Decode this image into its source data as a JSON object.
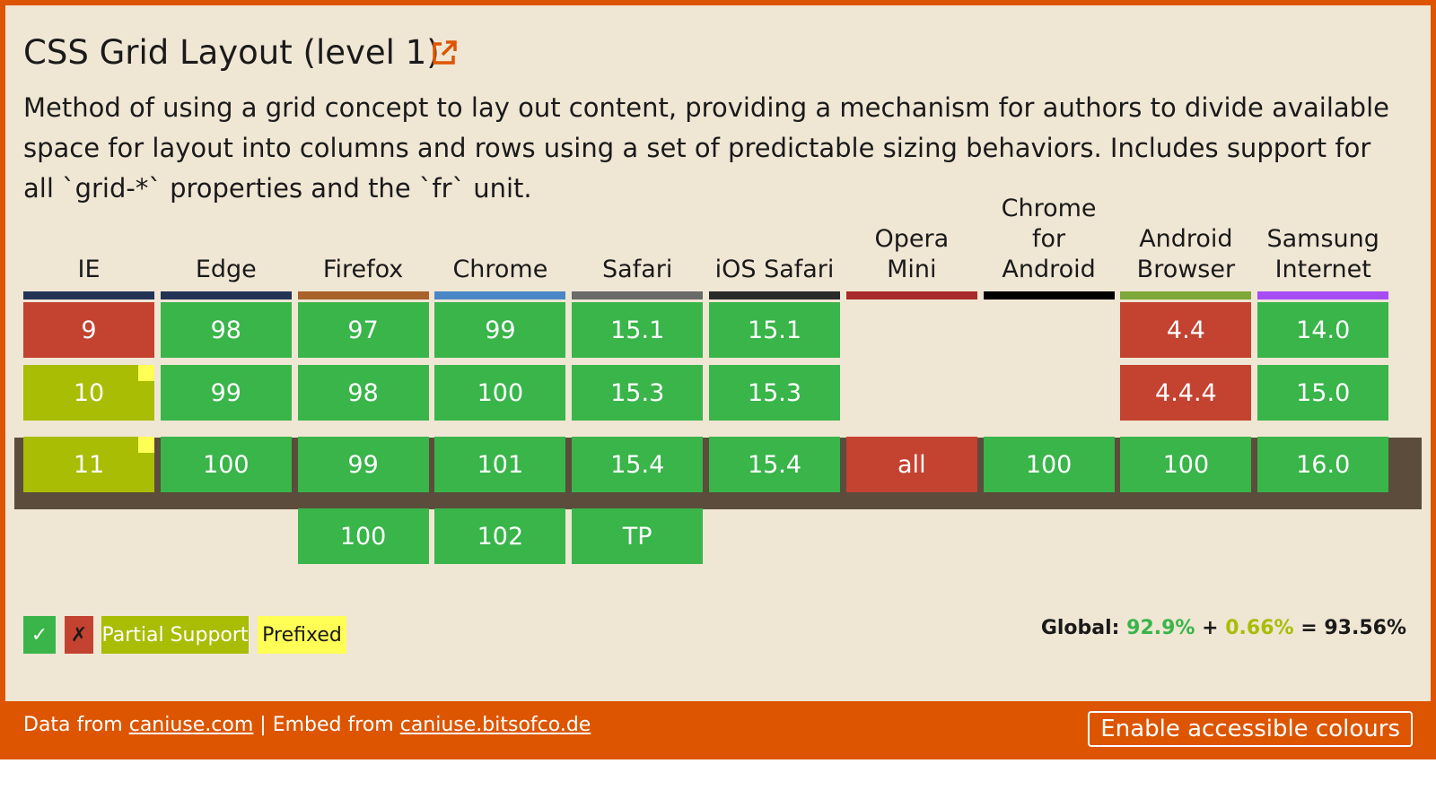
{
  "title": "CSS Grid Layout (level 1)",
  "description": "Method of using a grid concept to lay out content, providing a mechanism for authors to divide available space for layout into columns and rows using a set of predictable sizing behaviors. Includes support for all `grid-*` properties and the `fr` unit.",
  "icons": {
    "external_link": "external-link-icon"
  },
  "colors": {
    "supported": "#39b54a",
    "unsupported": "#c44230",
    "partial": "#a8bd04",
    "prefixed": "#ffff55",
    "frame": "#dd5500",
    "background": "#f0e6d4",
    "current_row": "#5b4c3c"
  },
  "browsers": [
    {
      "name": "IE",
      "color": "#223355"
    },
    {
      "name": "Edge",
      "color": "#223355"
    },
    {
      "name": "Firefox",
      "color": "#a8622a"
    },
    {
      "name": "Chrome",
      "color": "#4a87c6"
    },
    {
      "name": "Safari",
      "color": "#6a6a6a"
    },
    {
      "name": "iOS Safari",
      "color": "#2a2a2a"
    },
    {
      "name": "Opera Mini",
      "color": "#a82a2a"
    },
    {
      "name": "Chrome for Android",
      "color": "#000000"
    },
    {
      "name": "Android Browser",
      "color": "#7ea83a"
    },
    {
      "name": "Samsung Internet",
      "color": "#a64cf5"
    }
  ],
  "rows": [
    {
      "cells": [
        {
          "browser": "IE",
          "version": "9",
          "support": "n"
        },
        {
          "browser": "Edge",
          "version": "98",
          "support": "y"
        },
        {
          "browser": "Firefox",
          "version": "97",
          "support": "y"
        },
        {
          "browser": "Chrome",
          "version": "99",
          "support": "y"
        },
        {
          "browser": "Safari",
          "version": "15.1",
          "support": "y"
        },
        {
          "browser": "iOS Safari",
          "version": "15.1",
          "support": "y"
        },
        {
          "browser": "Android Browser",
          "version": "4.4",
          "support": "n"
        },
        {
          "browser": "Samsung Internet",
          "version": "14.0",
          "support": "y"
        }
      ]
    },
    {
      "cells": [
        {
          "browser": "IE",
          "version": "10",
          "support": "a",
          "prefixed": true
        },
        {
          "browser": "Edge",
          "version": "99",
          "support": "y"
        },
        {
          "browser": "Firefox",
          "version": "98",
          "support": "y"
        },
        {
          "browser": "Chrome",
          "version": "100",
          "support": "y"
        },
        {
          "browser": "Safari",
          "version": "15.3",
          "support": "y"
        },
        {
          "browser": "iOS Safari",
          "version": "15.3",
          "support": "y"
        },
        {
          "browser": "Android Browser",
          "version": "4.4.4",
          "support": "n"
        },
        {
          "browser": "Samsung Internet",
          "version": "15.0",
          "support": "y"
        }
      ]
    },
    {
      "current": true,
      "cells": [
        {
          "browser": "IE",
          "version": "11",
          "support": "a",
          "prefixed": true
        },
        {
          "browser": "Edge",
          "version": "100",
          "support": "y"
        },
        {
          "browser": "Firefox",
          "version": "99",
          "support": "y"
        },
        {
          "browser": "Chrome",
          "version": "101",
          "support": "y"
        },
        {
          "browser": "Safari",
          "version": "15.4",
          "support": "y"
        },
        {
          "browser": "iOS Safari",
          "version": "15.4",
          "support": "y"
        },
        {
          "browser": "Opera Mini",
          "version": "all",
          "support": "n"
        },
        {
          "browser": "Chrome for Android",
          "version": "100",
          "support": "y"
        },
        {
          "browser": "Android Browser",
          "version": "100",
          "support": "y"
        },
        {
          "browser": "Samsung Internet",
          "version": "16.0",
          "support": "y"
        }
      ]
    },
    {
      "cells": [
        {
          "browser": "Firefox",
          "version": "100",
          "support": "y"
        },
        {
          "browser": "Chrome",
          "version": "102",
          "support": "y"
        },
        {
          "browser": "Safari",
          "version": "TP",
          "support": "y"
        }
      ]
    }
  ],
  "legend": {
    "supported": "✓",
    "unsupported": "✗",
    "partial": "Partial Support",
    "prefixed": "Prefixed"
  },
  "global": {
    "label": "Global:",
    "full": "92.9%",
    "plus": "+",
    "partial": "0.66%",
    "equals": "=",
    "total": "93.56%"
  },
  "footer": {
    "data_from": "Data from",
    "data_link": "caniuse.com",
    "separator": "|",
    "embed_from": "Embed from",
    "embed_link": "caniuse.bitsofco.de",
    "accessible_button": "Enable accessible colours"
  }
}
